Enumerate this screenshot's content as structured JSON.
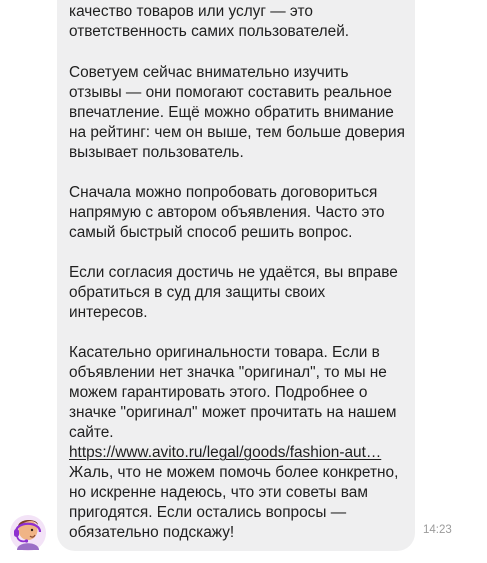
{
  "message": {
    "lines": [
      "качество товаров или услуг — это",
      "ответственность самих пользователей.",
      "Советуем сейчас внимательно изучить",
      "отзывы — они помогают составить реальное",
      "впечатление. Ещё можно обратить внимание",
      "на рейтинг: чем он выше, тем больше доверия",
      "вызывает пользователь.",
      "Сначала можно попробовать договориться",
      "напрямую с автором объявления. Часто это",
      "самый быстрый способ решить вопрос.",
      "Если согласия достичь не удаётся, вы вправе",
      "обратиться в суд для защиты своих",
      "интересов.",
      "Касательно оригинальности товара. Если в",
      "объявлении нет значка \"оригинал\", то мы не",
      "можем гарантировать этого. Подробнее о",
      "значке \"оригинал\" может прочитать на нашем",
      "сайте."
    ],
    "link_text": "https://www.avito.ru/legal/goods/fashion-aut…",
    "closing_lines": [
      "Жаль, что не можем помочь более конкретно,",
      "но искренне надеюсь, что эти советы вам",
      "пригодятся. Если остались вопросы —",
      "обязательно подскажу!"
    ],
    "time": "14:23"
  },
  "colors": {
    "bubble": "#efeff0",
    "avatar_bg": "#f3e3f7",
    "headset": "#8e2fd0"
  },
  "icons": {
    "avatar": "support-agent-avatar-icon"
  }
}
